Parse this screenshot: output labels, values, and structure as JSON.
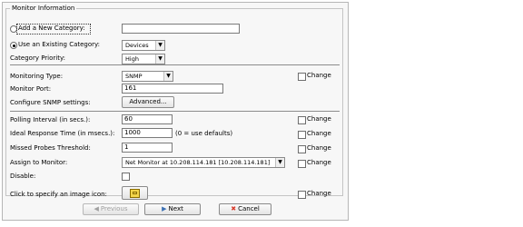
{
  "section_title": "Monitor Information",
  "category": {
    "add_new_label": "Add a New Category:",
    "add_new_value": "",
    "use_existing_label": "Use an Existing Category:",
    "existing_value": "Devices",
    "priority_label": "Category Priority:",
    "priority_value": "High"
  },
  "fields": {
    "monitoring_type_label": "Monitoring Type:",
    "monitoring_type_value": "SNMP",
    "monitor_port_label": "Monitor Port:",
    "monitor_port_value": "161",
    "snmp_settings_label": "Configure SNMP settings:",
    "advanced_button": "Advanced...",
    "polling_label": "Polling Interval (in secs.):",
    "polling_value": "60",
    "ideal_response_label": "Ideal Response Time (in msecs.):",
    "ideal_response_value": "1000",
    "ideal_response_hint": "(0 = use defaults)",
    "missed_probes_label": "Missed Probes Threshold:",
    "missed_probes_value": "1",
    "assign_label": "Assign to Monitor:",
    "assign_value": "Net Monitor at 10.208.114.181 [10.208.114.181]",
    "disable_label": "Disable:",
    "image_icon_label": "Click to specify an image icon:"
  },
  "change_label": "Change",
  "buttons": {
    "previous": "Previous",
    "next": "Next",
    "cancel": "Cancel"
  },
  "icons": {
    "previous": "previous-icon",
    "next": "next-icon",
    "cancel": "cancel-icon",
    "image": "image-icon"
  },
  "colors": {
    "cancel_icon": "#d83a2a",
    "next_icon": "#3a6fb3",
    "image_icon_bg": "#f3d54a"
  }
}
